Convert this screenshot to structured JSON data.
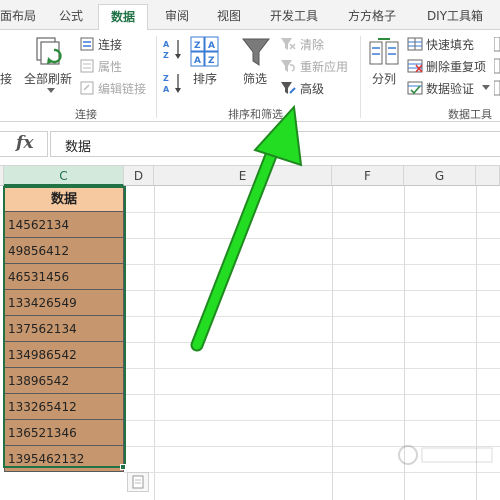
{
  "tabs": [
    {
      "label": "面布局",
      "active": false
    },
    {
      "label": "公式",
      "active": false
    },
    {
      "label": "数据",
      "active": true
    },
    {
      "label": "审阅",
      "active": false
    },
    {
      "label": "视图",
      "active": false
    },
    {
      "label": "开发工具",
      "active": false
    },
    {
      "label": "方方格子",
      "active": false
    },
    {
      "label": "DIY工具箱",
      "active": false
    }
  ],
  "ribbon": {
    "connections": {
      "partial_label": "接",
      "refresh_all": "全部刷新",
      "connections": "连接",
      "properties": "属性",
      "edit_links": "编辑链接",
      "group_label": "连接"
    },
    "sort_filter": {
      "sort": "排序",
      "filter": "筛选",
      "clear": "清除",
      "reapply": "重新应用",
      "advanced": "高级",
      "group_label": "排序和筛选"
    },
    "data_tools": {
      "text_to_columns": "分列",
      "flash_fill": "快速填充",
      "remove_duplicates": "删除重复项",
      "data_validation": "数据验证",
      "group_label": "数据工具"
    }
  },
  "formula_bar": {
    "fx": "fx",
    "value": "数据"
  },
  "sheet": {
    "column_headers": [
      "C",
      "D",
      "E",
      "F",
      "G"
    ],
    "selected_column": "C",
    "header_cell": "数据",
    "values": [
      "14562134",
      "49856412",
      "46531456",
      "133426549",
      "137562134",
      "134986542",
      "13896542",
      "133265412",
      "136521346",
      "1395462132"
    ]
  },
  "colors": {
    "accent": "#217346",
    "header_fill": "#f7c9a1",
    "data_fill": "#c6976e",
    "arrow": "#22dd22"
  }
}
